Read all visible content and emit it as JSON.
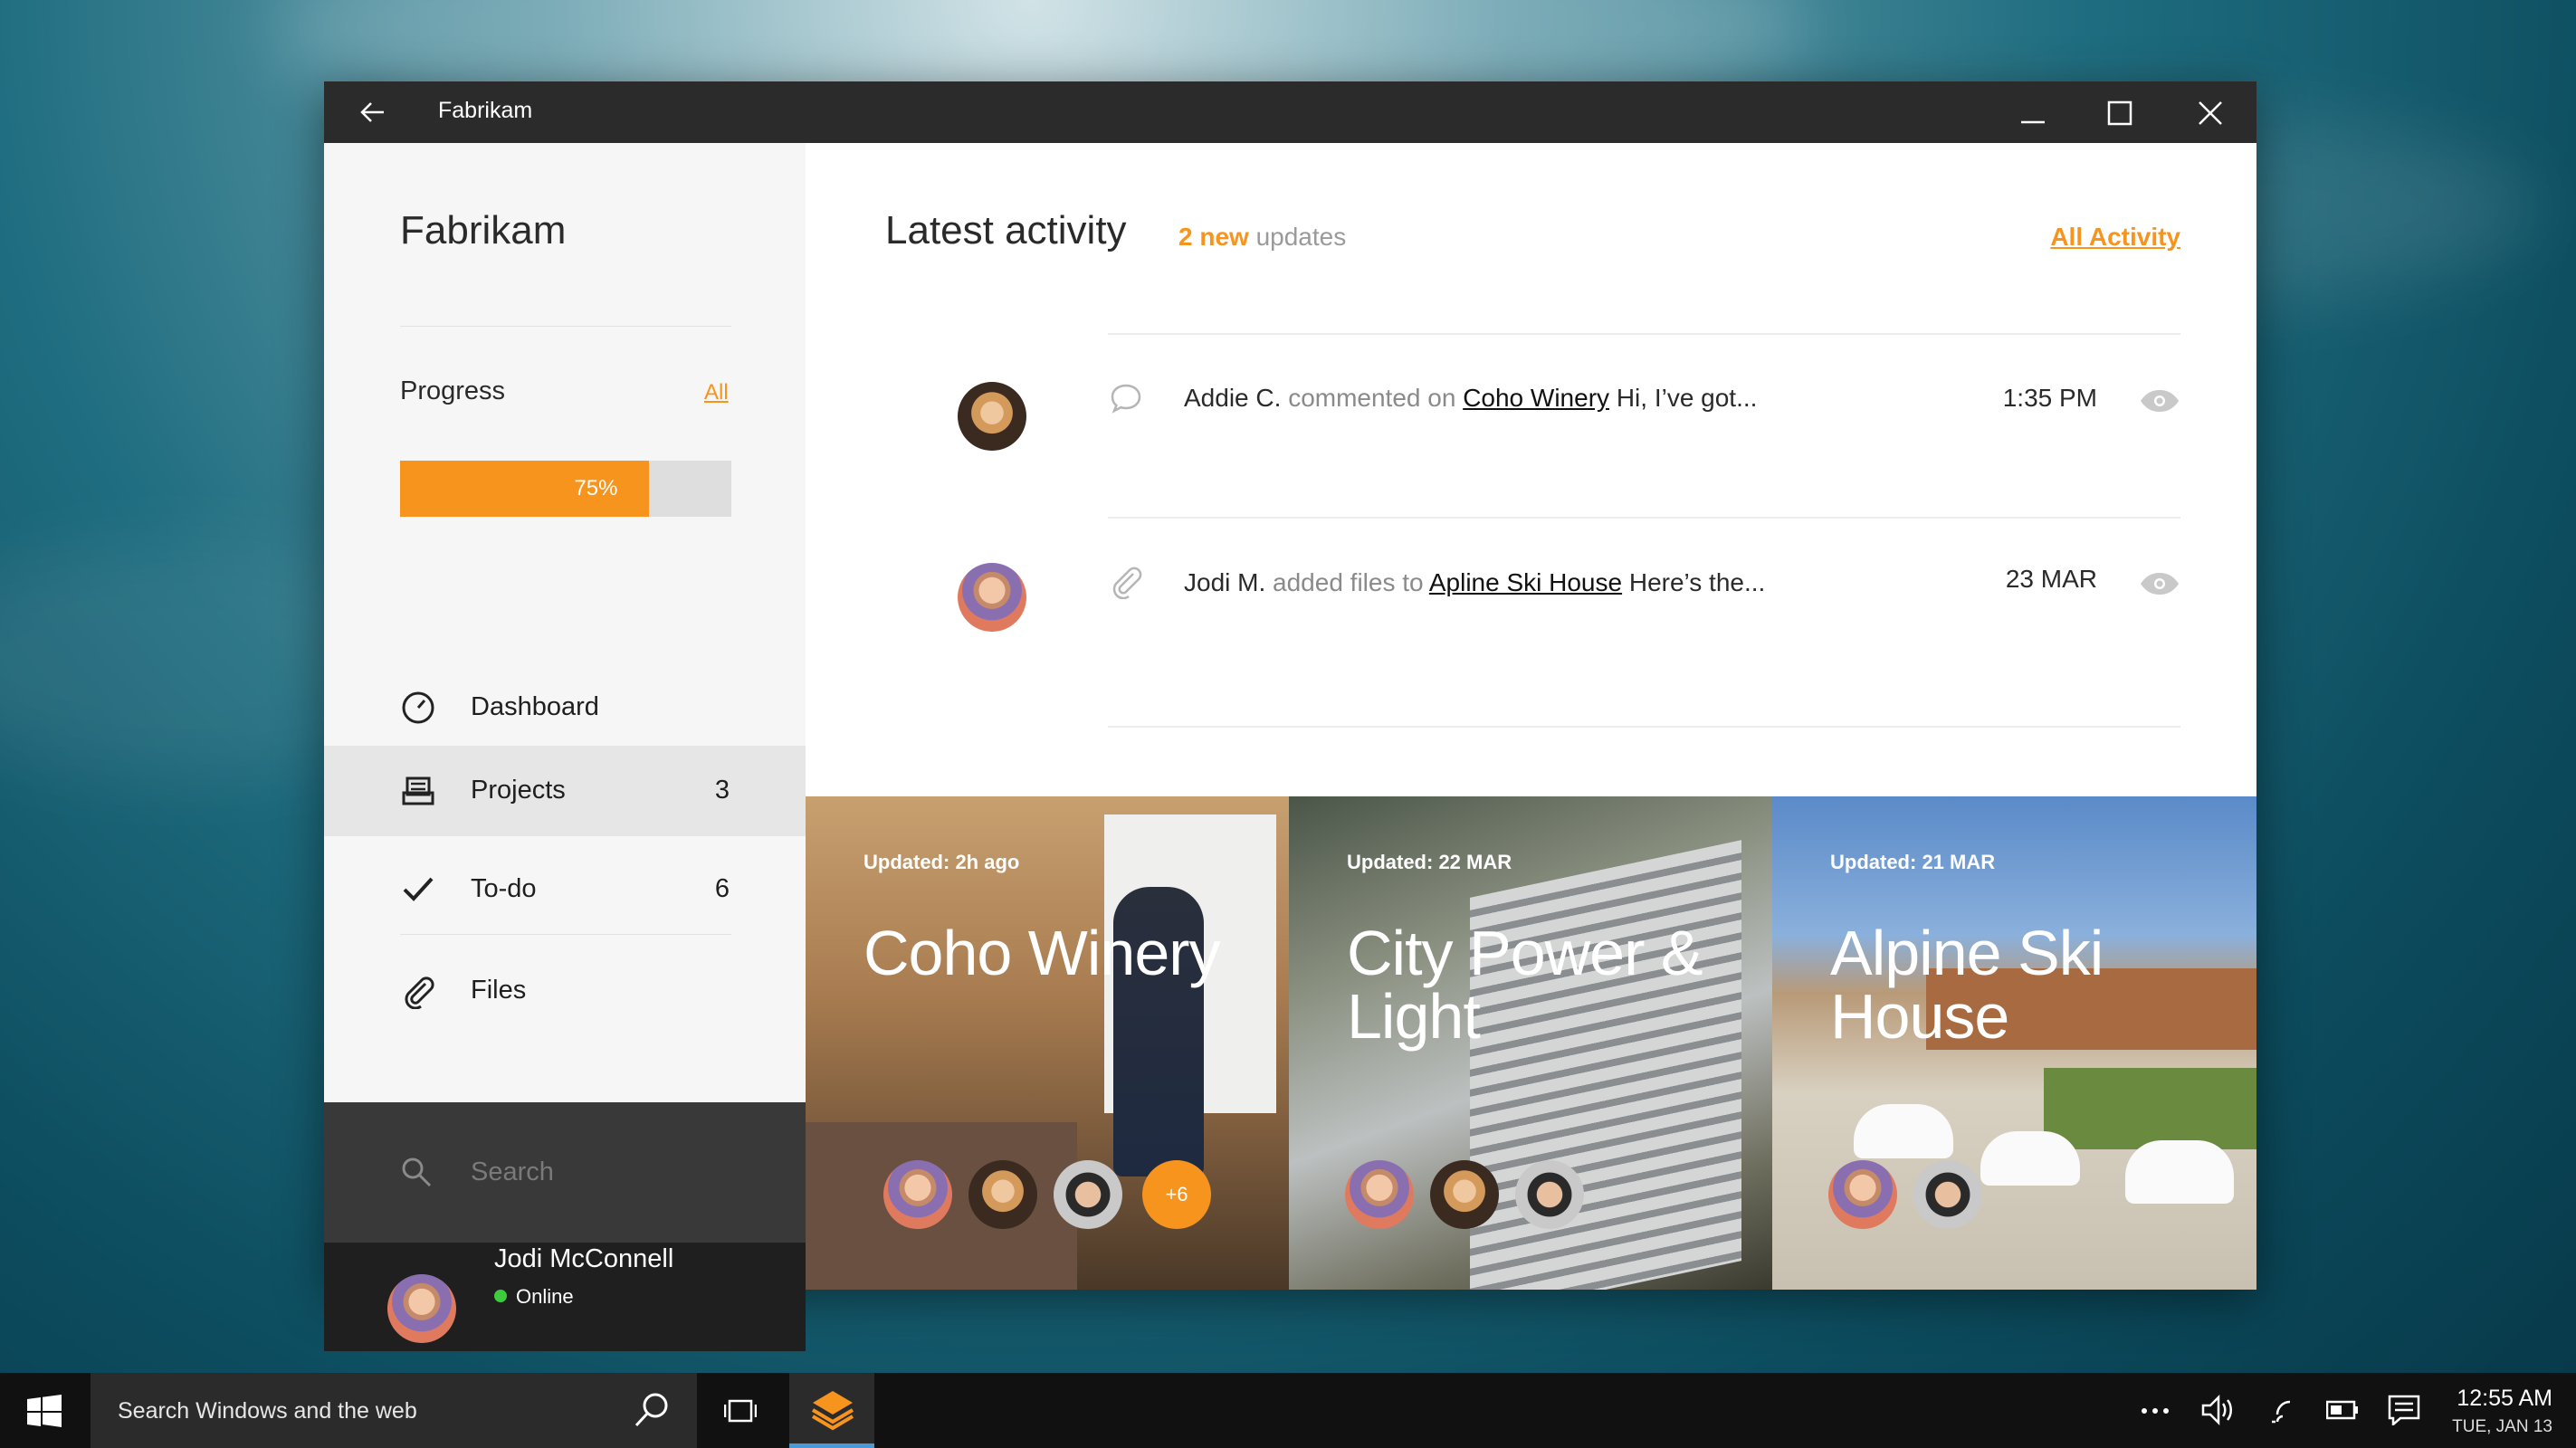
{
  "window": {
    "title": "Fabrikam"
  },
  "sidebar": {
    "app_name": "Fabrikam",
    "progress": {
      "label": "Progress",
      "all_link": "All",
      "value_text": "75%",
      "value": 0.75
    },
    "nav": [
      {
        "label": "Dashboard",
        "count": ""
      },
      {
        "label": "Projects",
        "count": "3"
      },
      {
        "label": "To-do",
        "count": "6"
      },
      {
        "label": "Files",
        "count": ""
      }
    ],
    "search_placeholder": "Search",
    "user": {
      "name": "Jodi McConnell",
      "status": "Online"
    }
  },
  "activity": {
    "title": "Latest activity",
    "new_count": "2 new",
    "new_suffix": "updates",
    "all_link": "All Activity",
    "items": [
      {
        "icon": "comment-icon",
        "who": "Addie C.",
        "action": "commented on",
        "target": "Coho Winery",
        "snippet": "Hi, I’ve got...",
        "time": "1:35 PM"
      },
      {
        "icon": "paperclip-icon",
        "who": "Jodi M.",
        "action": "added files to",
        "target": "Apline Ski House",
        "snippet": "Here’s the...",
        "time": "23 MAR"
      }
    ]
  },
  "projects": [
    {
      "updated": "Updated: 2h ago",
      "title": "Coho Winery",
      "more": "+6"
    },
    {
      "updated": "Updated: 22 MAR",
      "title": "City Power & Light",
      "more": ""
    },
    {
      "updated": "Updated: 21 MAR",
      "title": "Alpine Ski House",
      "more": ""
    }
  ],
  "taskbar": {
    "search_text": "Search Windows and the web",
    "time": "12:55 AM",
    "date": "TUE, JAN 13"
  },
  "colors": {
    "accent": "#f7941d",
    "online": "#3ecb3e",
    "titlebar": "#2b2b2b"
  }
}
